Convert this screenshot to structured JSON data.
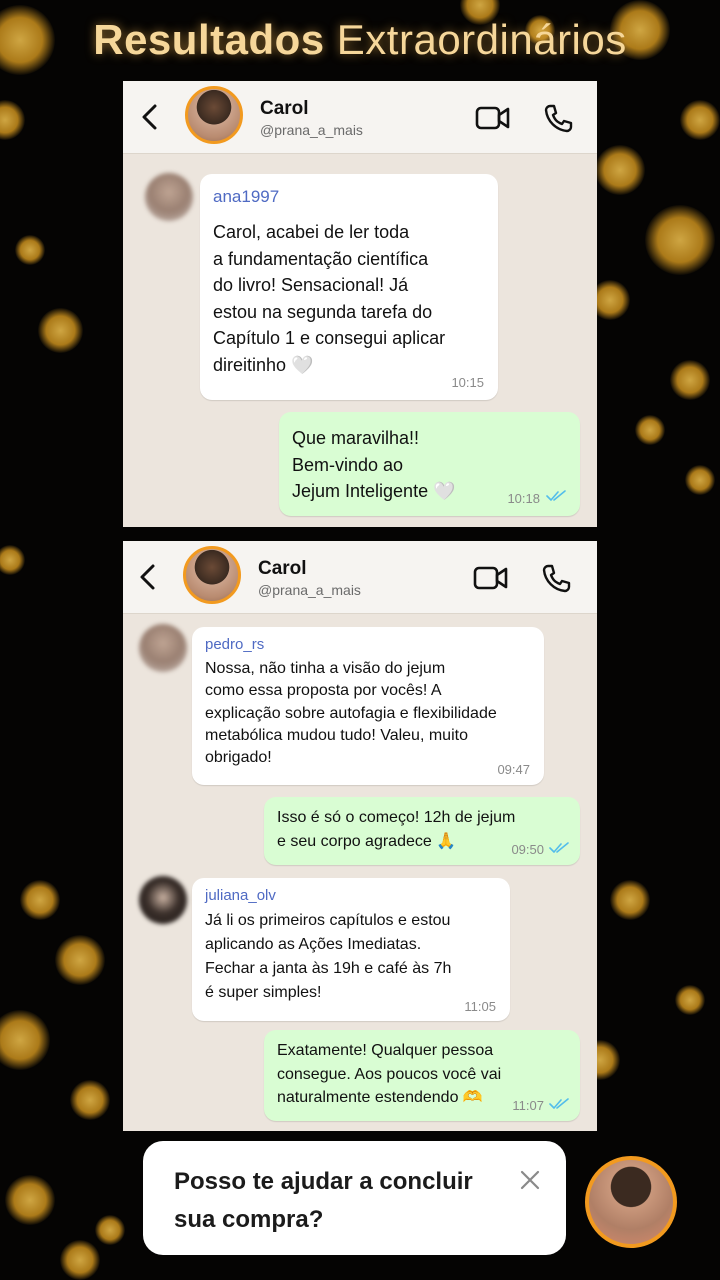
{
  "title": {
    "bold": "Resultados",
    "light": "Extraordinários"
  },
  "colors": {
    "accent": "#f29a1f",
    "gold": "#f6d79a",
    "incoming": "#ffffff",
    "outgoing": "#d9fdd3",
    "chat_bg": "#ece5dd",
    "sender_name": "#4f6ac3",
    "read_ticks": "#53bdeb"
  },
  "icons": {
    "back": "chevron-left-icon",
    "video": "video-camera-icon",
    "phone": "phone-icon",
    "ticks": "double-check-icon",
    "close": "close-icon"
  },
  "chat1": {
    "header": {
      "name": "Carol",
      "handle": "@prana_a_mais"
    },
    "messages": [
      {
        "sender": "ana1997",
        "text": "Carol, acabei de ler toda\na fundamentação científica\ndo livro! Sensacional! Já\nestou na segunda tarefa do\nCapítulo 1 e consegui aplicar\ndireitinho 🤍",
        "time": "10:15"
      },
      {
        "text": "Que maravilha!!\nBem-vindo ao\nJejum Inteligente 🤍",
        "time": "10:18"
      }
    ]
  },
  "chat2": {
    "header": {
      "name": "Carol",
      "handle": "@prana_a_mais"
    },
    "messages": [
      {
        "sender": "pedro_rs",
        "text": "Nossa, não tinha a visão do jejum\ncomo essa proposta por vocês! A\nexplicação sobre autofagia e flexibilidade\nmetabólica mudou tudo! Valeu, muito\nobrigado!",
        "time": "09:47"
      },
      {
        "text": "Isso é só o começo! 12h de jejum\ne seu corpo agradece 🙏",
        "time": "09:50"
      },
      {
        "sender": "juliana_olv",
        "text": "Já li os primeiros capítulos e estou\naplicando as Ações Imediatas.\nFechar a janta às 19h e café às 7h\né super simples!",
        "time": "11:05"
      },
      {
        "text": "Exatamente! Qualquer pessoa\nconsegue. Aos poucos você vai\nnaturalmente estendendo 🫶",
        "time": "11:07"
      }
    ]
  },
  "help_popup": {
    "text": "Posso te ajudar a concluir\nsua compra?"
  }
}
